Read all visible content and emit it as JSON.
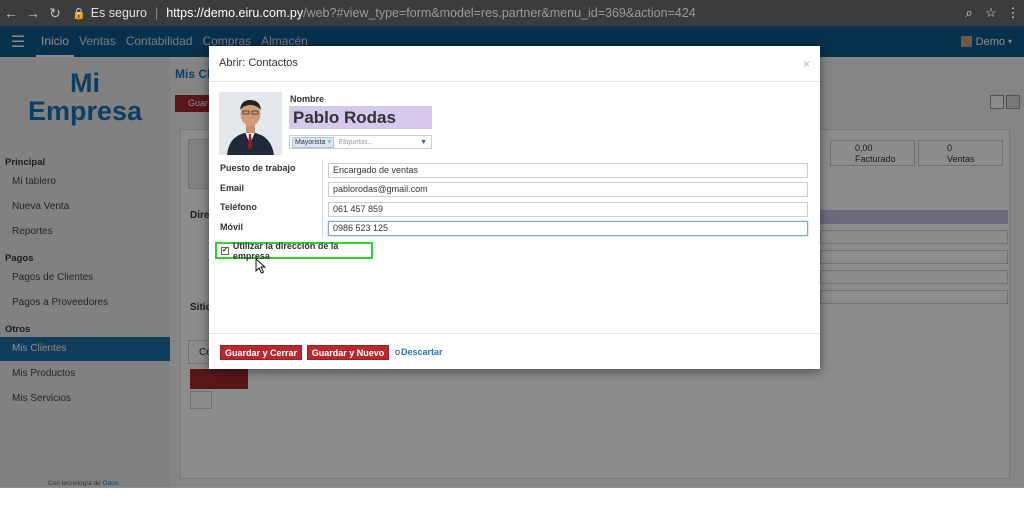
{
  "browser": {
    "secure_label": "Es seguro",
    "url_host": "https://demo.eiru.com.py",
    "url_path": "/web?#view_type=form&model=res.partner&menu_id=369&action=424"
  },
  "topbar": {
    "menu": [
      "Inicio",
      "Ventas",
      "Contabilidad",
      "Compras",
      "Almacén"
    ],
    "user": "Demo"
  },
  "sidebar": {
    "logo_line1": "Mi",
    "logo_line2": "Empresa",
    "sections": [
      {
        "title": "Principal",
        "items": [
          "Mi tablero",
          "Nueva Venta",
          "Reportes"
        ]
      },
      {
        "title": "Pagos",
        "items": [
          "Pagos de Clientes",
          "Pagos a Proveedores"
        ]
      },
      {
        "title": "Otros",
        "items": [
          "Mis Clientes",
          "Mis Productos",
          "Mis Servicios"
        ]
      }
    ],
    "active_item": "Mis Clientes",
    "powered_prefix": "Con tecnología de",
    "powered_brand": "Odoo"
  },
  "background": {
    "partial_title": "Mis Cl",
    "save_partial": "Guar",
    "stat1_value": "0,00",
    "stat1_label": "Facturado",
    "stat2_value": "0",
    "stat2_label": "Ventas",
    "label_dir": "Direc",
    "label_sitio": "Sitio",
    "tab_partial": "Co"
  },
  "modal": {
    "title": "Abrir: Contactos",
    "name_label": "Nombre",
    "name_value": "Pablo Rodas",
    "tag": "Mayorista",
    "tags_placeholder": "Etiquetas...",
    "fields": [
      {
        "label": "Puesto de trabajo",
        "value": "Encargado de ventas"
      },
      {
        "label": "Email",
        "value": "pablorodas@gmail.com"
      },
      {
        "label": "Teléfono",
        "value": "061 457 859"
      },
      {
        "label": "Móvil",
        "value": "0986 523 125"
      }
    ],
    "checkbox_label": "Utilizar la dirección de la empresa",
    "checkbox_checked": true,
    "btn_save_close": "Guardar y Cerrar",
    "btn_save_new": "Guardar y Nuevo",
    "or_text": "o",
    "discard": "Descartar"
  }
}
